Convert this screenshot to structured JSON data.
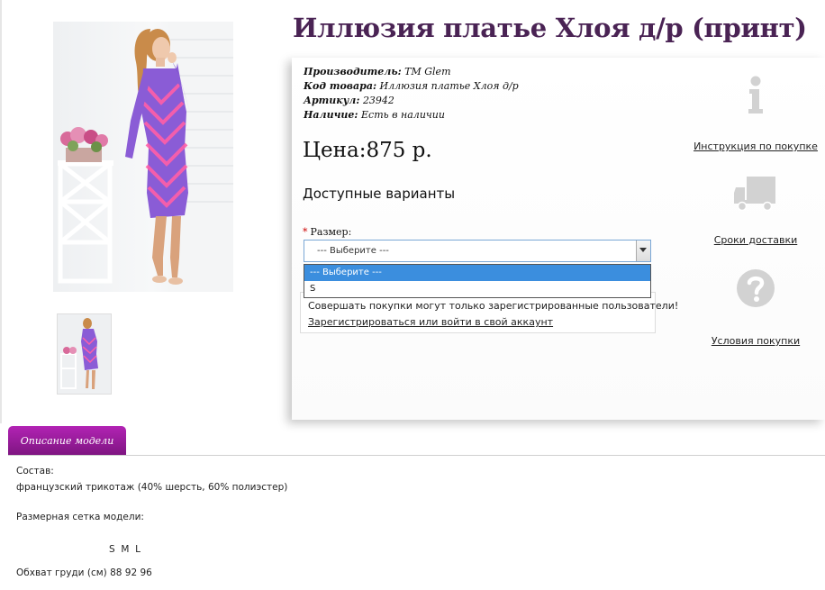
{
  "product": {
    "title": "Иллюзия платье Хлоя д/р (принт)",
    "meta": [
      {
        "label": "Производитель:",
        "value": "ТМ Glem"
      },
      {
        "label": "Код товара:",
        "value": "Иллюзия платье Хлоя д/р"
      },
      {
        "label": "Артикул:",
        "value": "23942"
      },
      {
        "label": "Наличие:",
        "value": "Есть в наличии"
      }
    ],
    "price": "Цена:875 р."
  },
  "options": {
    "heading": "Доступные варианты",
    "size_required_mark": "*",
    "size_label": "Размер:",
    "selected": "--- Выберите ---",
    "dropdown_options": [
      "--- Выберите ---",
      "S"
    ]
  },
  "notice": {
    "message": "Совершать покупки могут только зарегистрированные пользователи!",
    "link": "Зарегистрироваться или войти в свой аккаунт"
  },
  "side_links": [
    {
      "label": "Инструкция по покупке",
      "icon": "info-icon"
    },
    {
      "label": "Сроки доставки",
      "icon": "truck-icon"
    },
    {
      "label": "Условия покупки",
      "icon": "question-icon"
    }
  ],
  "tabs": [
    {
      "label": "Описание модели",
      "active": true
    }
  ],
  "description": {
    "composition_label": "Состав:",
    "composition_value": "французский трикотаж (40% шерсть, 60% полиэстер)",
    "size_grid_label": "Размерная сетка модели:",
    "size_header": "S  M  L",
    "chest_row": "Обхват груди (см) 88 92 96"
  },
  "colors": {
    "title": "#4a2354",
    "tab": "#9b1d9e",
    "dropdown_highlight": "#3b8ede",
    "icon_gray": "#d2d2d2",
    "required": "#cc0000"
  }
}
